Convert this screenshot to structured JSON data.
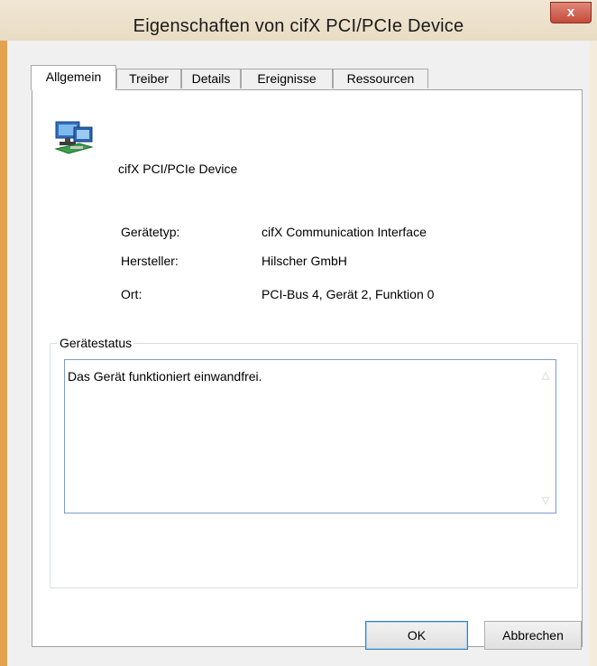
{
  "window": {
    "title": "Eigenschaften von cifX PCI/PCIe Device",
    "close_symbol": "x"
  },
  "tabs": [
    {
      "label": "Allgemein",
      "active": true
    },
    {
      "label": "Treiber",
      "active": false
    },
    {
      "label": "Details",
      "active": false
    },
    {
      "label": "Ereignisse",
      "active": false
    },
    {
      "label": "Ressourcen",
      "active": false
    }
  ],
  "device": {
    "icon": "network-adapter-icon",
    "name": "cifX PCI/PCIe Device"
  },
  "properties": [
    {
      "label": "Gerätetyp:",
      "value": "cifX Communication Interface"
    },
    {
      "label": "Hersteller:",
      "value": "Hilscher GmbH"
    },
    {
      "label": "Ort:",
      "value": "PCI-Bus 4, Gerät 2, Funktion 0"
    }
  ],
  "status": {
    "group_label": "Gerätestatus",
    "text": "Das Gerät funktioniert einwandfrei."
  },
  "buttons": {
    "ok": "OK",
    "cancel": "Abbrechen"
  },
  "colors": {
    "title_bar": "#efe3cf",
    "close_button": "#c7503f",
    "window_border_accent": "#e3a24f"
  }
}
